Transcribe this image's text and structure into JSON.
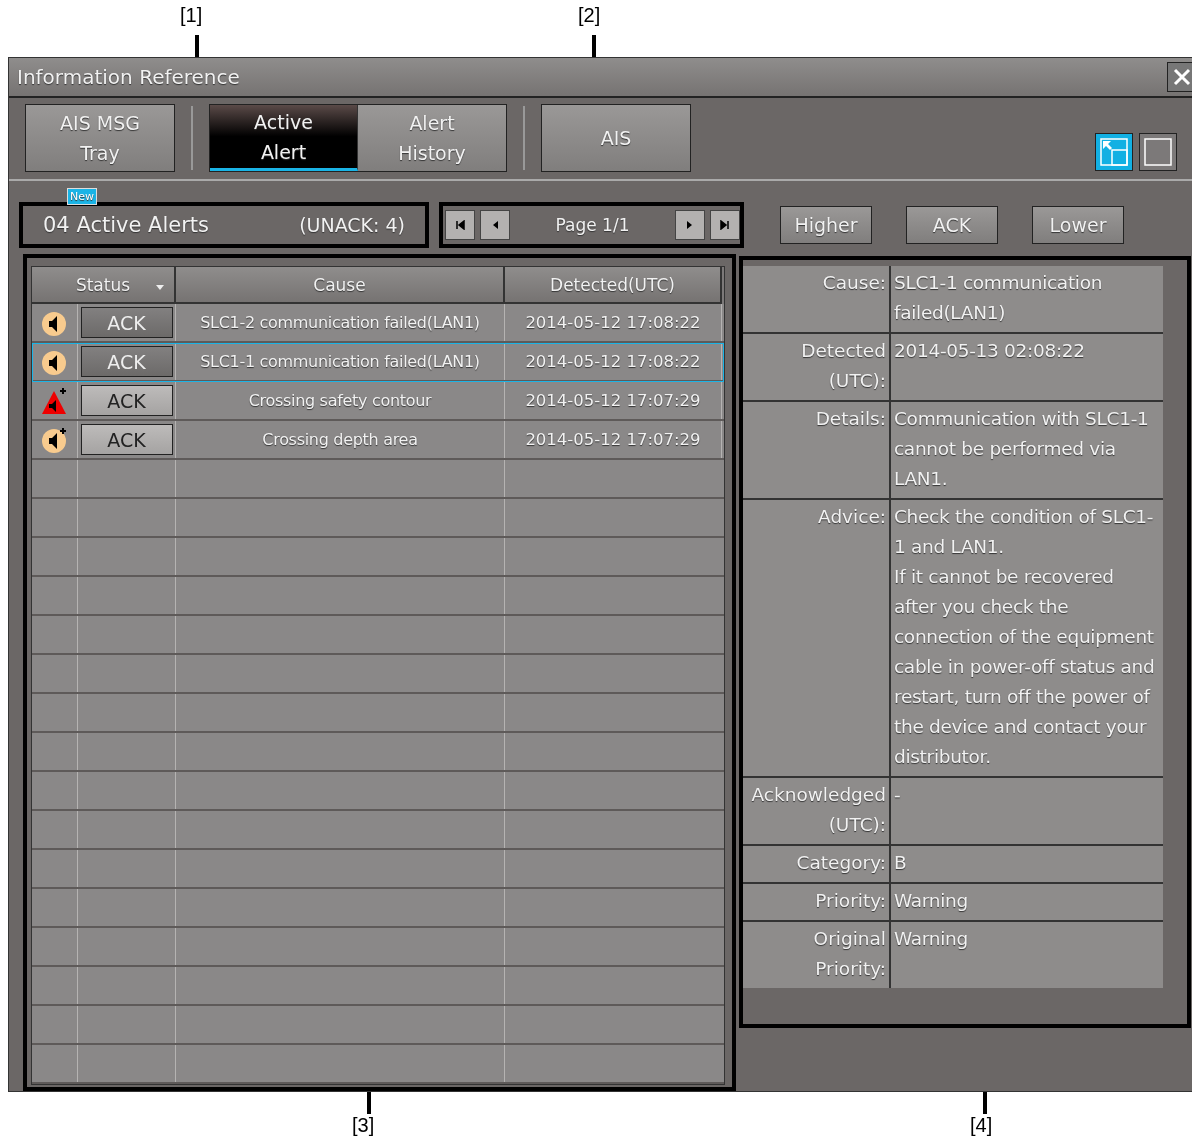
{
  "callouts": [
    {
      "label": "[1]",
      "kind": "top"
    },
    {
      "label": "[2]",
      "kind": "top"
    },
    {
      "label": "[3]",
      "kind": "bottom"
    },
    {
      "label": "[4]",
      "kind": "bottom"
    }
  ],
  "window": {
    "title": "Information Reference"
  },
  "tab_groups": [
    {
      "tabs": [
        {
          "label": "AIS MSG\nTray",
          "selected": false,
          "badge": "New"
        }
      ]
    },
    {
      "tabs": [
        {
          "label": "Active\nAlert",
          "selected": true
        },
        {
          "label": "Alert\nHistory",
          "selected": false
        }
      ]
    },
    {
      "tabs": [
        {
          "label": "AIS",
          "selected": false
        }
      ]
    }
  ],
  "layout_toggles": [
    {
      "kind": "split",
      "selected": true
    },
    {
      "kind": "single",
      "selected": false
    }
  ],
  "summary": {
    "count": "04 Active Alerts",
    "unack": "(UNACK: 4)"
  },
  "pager": {
    "label": "Page 1/1"
  },
  "actions": [
    "Higher",
    "ACK",
    "Lower"
  ],
  "table": {
    "columns": [
      "Status",
      "Cause",
      "Detected(UTC)"
    ],
    "rows": [
      {
        "kind": "speaker",
        "ack": "ACK",
        "ack_enabled": false,
        "cause": "SLC1-2 communication failed(LAN1)",
        "detected": "2014-05-12 17:08:22",
        "selected": false
      },
      {
        "kind": "speaker",
        "ack": "ACK",
        "ack_enabled": false,
        "cause": "SLC1-1 communication failed(LAN1)",
        "detected": "2014-05-12 17:08:22",
        "selected": true
      },
      {
        "kind": "triangle_plus",
        "ack": "ACK",
        "ack_enabled": true,
        "cause": "Crossing safety contour",
        "detected": "2014-05-12 17:07:29",
        "selected": false
      },
      {
        "kind": "speaker_plus",
        "ack": "ACK",
        "ack_enabled": true,
        "cause": "Crossing depth area",
        "detected": "2014-05-12 17:07:29",
        "selected": false
      }
    ]
  },
  "details": [
    {
      "label": "Cause:",
      "value": "SLC1-1 communication failed(LAN1)"
    },
    {
      "label": "Detected (UTC):",
      "value": "2014-05-13 02:08:22"
    },
    {
      "label": "Details:",
      "value": "Communication with SLC1-1 cannot be performed via LAN1."
    },
    {
      "label": "Advice:",
      "value": "Check the condition of SLC1-1 and LAN1.\nIf it cannot be recovered after you check the connection of the equipment cable in power-off status and restart, turn off the power of the device and contact your distributor."
    },
    {
      "label": "Acknowledged (UTC):",
      "value": "-"
    },
    {
      "label": "Category:",
      "value": "B"
    },
    {
      "label": "Priority:",
      "value": "Warning"
    },
    {
      "label": "Original Priority:",
      "value": "Warning"
    }
  ]
}
